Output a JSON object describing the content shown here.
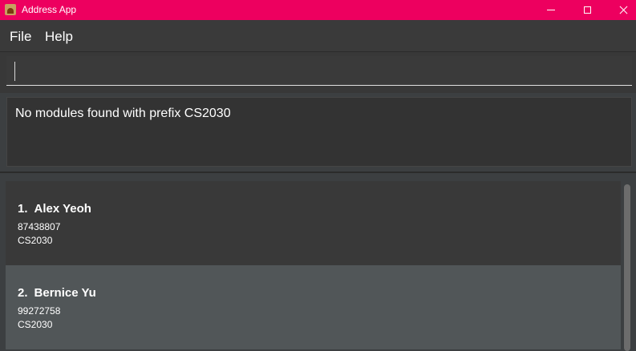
{
  "window": {
    "title": "Address App",
    "accent_color": "#ed005f"
  },
  "menu": {
    "items": [
      {
        "label": "File"
      },
      {
        "label": "Help"
      }
    ]
  },
  "command": {
    "value": "",
    "placeholder": ""
  },
  "result": {
    "text": "No modules found with prefix CS2030"
  },
  "persons": [
    {
      "index": "1.",
      "name": "Alex Yeoh",
      "phone": "87438807",
      "module": "CS2030"
    },
    {
      "index": "2.",
      "name": "Bernice Yu",
      "phone": "99272758",
      "module": "CS2030"
    }
  ]
}
